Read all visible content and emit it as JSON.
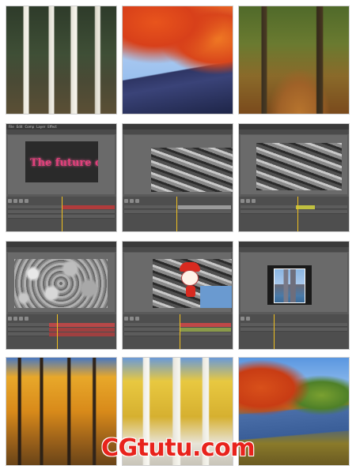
{
  "gallery": {
    "rows": [
      {
        "label": "autumn-photos-top"
      },
      {
        "label": "after-effects-screens-1"
      },
      {
        "label": "after-effects-screens-2"
      },
      {
        "label": "autumn-photos-bottom"
      }
    ]
  },
  "ae_panels": {
    "menu_items": [
      "File",
      "Edit",
      "Comp",
      "Layer",
      "Effect"
    ],
    "title_text": "The future city"
  },
  "watermark": {
    "text": "CGtutu.com",
    "color": "#e8231c"
  }
}
